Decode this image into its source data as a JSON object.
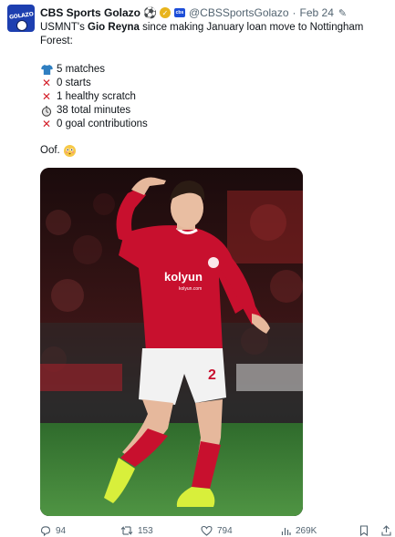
{
  "author": {
    "name": "CBS Sports Golazo",
    "name_emoji": "⚽",
    "handle": "@CBSSportsGolazo",
    "separator": "·",
    "date": "Feb 24",
    "avatar_text": "GOLAZO",
    "verified_icon": "gold-check-icon",
    "affiliate_icon": "cbs-badge-icon"
  },
  "tweet": {
    "line_prefix": "USMNT's ",
    "player": "Gio Reyna",
    "line_suffix": " since making January loan move to Nottingham Forest:",
    "stats": [
      {
        "icon": "jersey-icon",
        "text": "5 matches"
      },
      {
        "icon": "cross-mark-icon",
        "text": "0 starts"
      },
      {
        "icon": "cross-mark-icon",
        "text": "1 healthy scratch"
      },
      {
        "icon": "stopwatch-icon",
        "text": "38 total minutes"
      },
      {
        "icon": "cross-mark-icon",
        "text": "0 goal contributions"
      }
    ],
    "closing": "Oof.",
    "closing_emoji": "flushed-face-icon"
  },
  "photo": {
    "jersey_number": "2",
    "sponsor": "kolyun",
    "sponsor_sub": "kolyun.com"
  },
  "actions": {
    "replies": "94",
    "retweets": "153",
    "likes": "794",
    "views": "269K"
  },
  "colors": {
    "kit_red": "#c8102e",
    "muted": "#536471",
    "text": "#0f1419"
  }
}
